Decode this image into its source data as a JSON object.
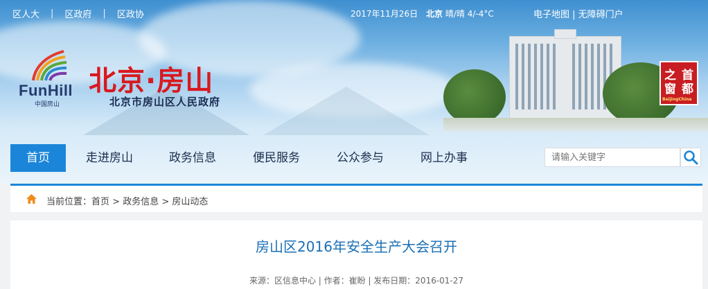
{
  "top_links": [
    "区人大",
    "区政府",
    "区政协"
  ],
  "date": "2017年11月26日",
  "weather": {
    "city": "北京",
    "condition": "晴/晴 4/-4°C"
  },
  "right_links": [
    "电子地图",
    "无障碍门户"
  ],
  "logo": {
    "en": "FunHill",
    "cn": "中国房山"
  },
  "site": {
    "title": "北京·房山",
    "subtitle": "北京市房山区人民政府"
  },
  "seal": {
    "chars": [
      "首",
      "都",
      "之",
      "窗"
    ],
    "small": "BeijingChina"
  },
  "nav": [
    "首页",
    "走进房山",
    "政务信息",
    "便民服务",
    "公众参与",
    "网上办事"
  ],
  "search": {
    "placeholder": "请输入关键字"
  },
  "breadcrumb": {
    "prefix": "当前位置：",
    "items": [
      "首页",
      "政务信息",
      "房山动态"
    ],
    "sep": " > "
  },
  "article": {
    "title": "房山区2016年安全生产大会召开",
    "meta": "来源：区信息中心 | 作者：崔盼 | 发布日期：2016-01-27"
  },
  "colors": {
    "accent": "#1b86d9",
    "title_red": "#d8191f",
    "article_title": "#1a6fb6"
  }
}
